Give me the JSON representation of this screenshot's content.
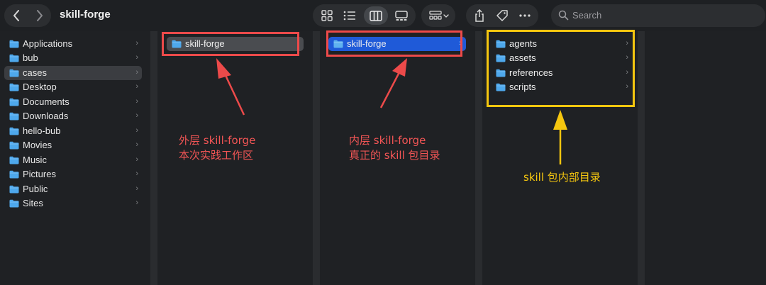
{
  "window": {
    "title": "skill-forge",
    "search_placeholder": "Search"
  },
  "toolbar": {
    "icons": [
      "chevron-left-icon",
      "chevron-right-icon",
      "grid-view-icon",
      "list-view-icon",
      "column-view-icon",
      "gallery-view-icon",
      "group-by-icon",
      "share-icon",
      "tag-icon",
      "more-icon",
      "search-icon"
    ],
    "active_view": "column"
  },
  "sidebar": {
    "items": [
      {
        "label": "Applications"
      },
      {
        "label": "bub"
      },
      {
        "label": "cases",
        "selected": true
      },
      {
        "label": "Desktop"
      },
      {
        "label": "Documents"
      },
      {
        "label": "Downloads"
      },
      {
        "label": "hello-bub"
      },
      {
        "label": "Movies"
      },
      {
        "label": "Music"
      },
      {
        "label": "Pictures"
      },
      {
        "label": "Public"
      },
      {
        "label": "Sites"
      }
    ]
  },
  "columns": {
    "col1": {
      "items": [
        {
          "label": "skill-forge"
        }
      ]
    },
    "col2": {
      "items": [
        {
          "label": "skill-forge"
        }
      ]
    },
    "col3": {
      "items": [
        {
          "label": "agents"
        },
        {
          "label": "assets"
        },
        {
          "label": "references"
        },
        {
          "label": "scripts"
        }
      ]
    }
  },
  "annotations": {
    "outer_line1": "外层 skill-forge",
    "outer_line2": "本次实践工作区",
    "inner_line1": "内层 skill-forge",
    "inner_line2": "真正的 skill 包目录",
    "package": "skill 包内部目录"
  },
  "colors": {
    "background": "#1f2124",
    "selection_blue": "#1f5ad8",
    "annotation_red": "#ec4a4a",
    "annotation_yellow": "#f5c60f",
    "folder_blue": "#4ea8ec"
  }
}
